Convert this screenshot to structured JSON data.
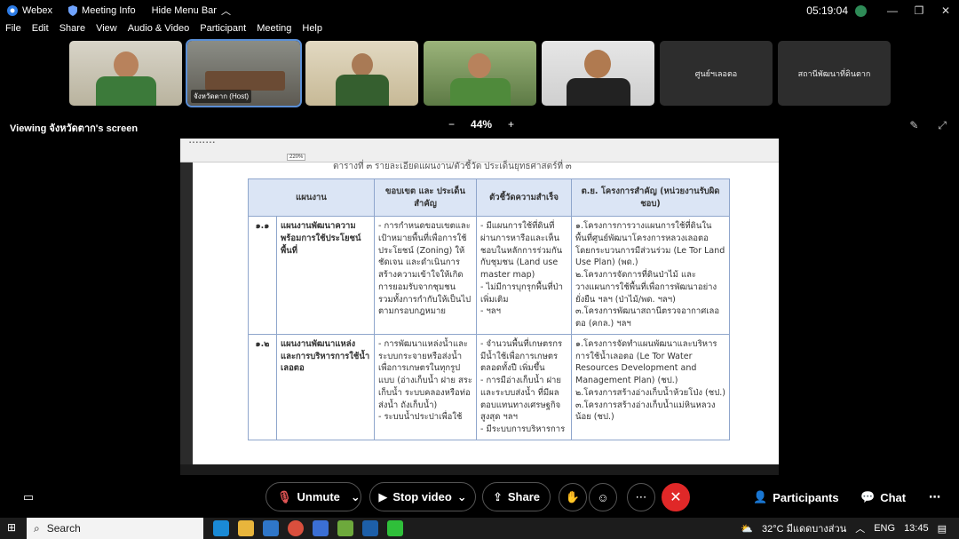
{
  "window": {
    "app_name": "Webex",
    "meeting_info": "Meeting Info",
    "hide_menu": "Hide Menu Bar",
    "clock": "05:19:04"
  },
  "menu": [
    "File",
    "Edit",
    "Share",
    "View",
    "Audio & Video",
    "Participant",
    "Meeting",
    "Help"
  ],
  "participants": [
    {
      "label": ""
    },
    {
      "label": "จังหวัดตาก (Host)"
    },
    {
      "label": ""
    },
    {
      "label": ""
    },
    {
      "label": ""
    },
    {
      "label": "ศูนย์ฯเลอตอ"
    },
    {
      "label": "สถานีพัฒนาที่ดินตาก"
    }
  ],
  "viewing": {
    "text": "Viewing จังหวัดตาก's screen",
    "zoom_minus": "−",
    "zoom": "44%",
    "zoom_plus": "+"
  },
  "shared_doc": {
    "caption": "ตารางที่ ๓ รายละเอียดแผนงาน/ตัวชี้วัด ประเด็นยุทธศาสตร์ที่ ๓",
    "zoom": "220%",
    "headers": {
      "plan": "แผนงาน",
      "scope": "ขอบเขต และ ประเด็นสำคัญ",
      "indicator": "ตัวชี้วัดความสำเร็จ",
      "projects": "ต.ย. โครงการสำคัญ (หน่วยงานรับผิดชอบ)"
    },
    "rows": [
      {
        "num": "๑.๑",
        "plan": "แผนงานพัฒนาความพร้อมการใช้ประโยชน์พื้นที่",
        "scope": "- การกำหนดขอบเขตและเป้าหมายพื้นที่เพื่อการใช้ประโยชน์ (Zoning) ให้ชัดเจน และดำเนินการสร้างความเข้าใจให้เกิดการยอมรับจากชุมชน รวมทั้งการกำกับให้เป็นไปตามกรอบกฎหมาย",
        "indicator": "- มีแผนการใช้ที่ดินที่ผ่านการหารือและเห็นชอบในหลักการร่วมกันกับชุมชน (Land use master map)\n- ไม่มีการบุกรุกพื้นที่ป่าเพิ่มเติม\n- ฯลฯ",
        "projects": "๑.โครงการการวางแผนการใช้ที่ดินในพื้นที่ศูนย์พัฒนาโครงการหลวงเลอตอ โดยกระบวนการมีส่วนร่วม (Le Tor Land Use Plan) (พด.)\n๒.โครงการจัดการที่ดินป่าไม้ และวางแผนการใช้พื้นที่เพื่อการพัฒนาอย่างยั่งยืน ฯลฯ (ป่าไม้/พด. ฯลฯ)\n๓.โครงการพัฒนาสถานีตรวจอากาศเลอตอ (คกล.) ฯลฯ"
      },
      {
        "num": "๑.๒",
        "plan": "แผนงานพัฒนาแหล่งและการบริหารการใช้น้ำเลอตอ",
        "scope": "- การพัฒนาแหล่งน้ำและระบบกระจายหรือส่งน้ำเพื่อการเกษตรในทุกรูปแบบ (อ่างเก็บน้ำ ฝาย สระเก็บน้ำ ระบบคลองหรือท่อส่งน้ำ ถังเก็บน้ำ)\n- ระบบน้ำประปาเพื่อใช้",
        "indicator": "- จำนวนพื้นที่เกษตรกรมีน้ำใช้เพื่อการเกษตรตลอดทั้งปี เพิ่มขึ้น\n- การมีอ่างเก็บน้ำ ฝาย และระบบส่งน้ำ ที่มีผลตอบแทนทางเศรษฐกิจสูงสุด ฯลฯ\n- มีระบบการบริหารการ",
        "projects": "๑.โครงการจัดทำแผนพัฒนาและบริหารการใช้น้ำเลอตอ (Le Tor Water Resources Development and Management Plan) (ชป.)\n๒.โครงการสร้างอ่างเก็บน้ำห้วยโป่ง (ชป.)\n๓.โครงการสร้างอ่างเก็บน้ำแม่หินหลวงน้อย (ชป.)"
      }
    ]
  },
  "controls": {
    "mute": "Unmute",
    "video": "Stop video",
    "share": "Share",
    "participants": "Participants",
    "chat": "Chat"
  },
  "taskbar": {
    "search": "Search",
    "weather": "32°C มีแดดบางส่วน",
    "lang": "ENG",
    "time": "13:45"
  },
  "colors": {
    "end": "#e02828",
    "selection": "#5b8fd6",
    "table_header": "#dbe5f5"
  }
}
